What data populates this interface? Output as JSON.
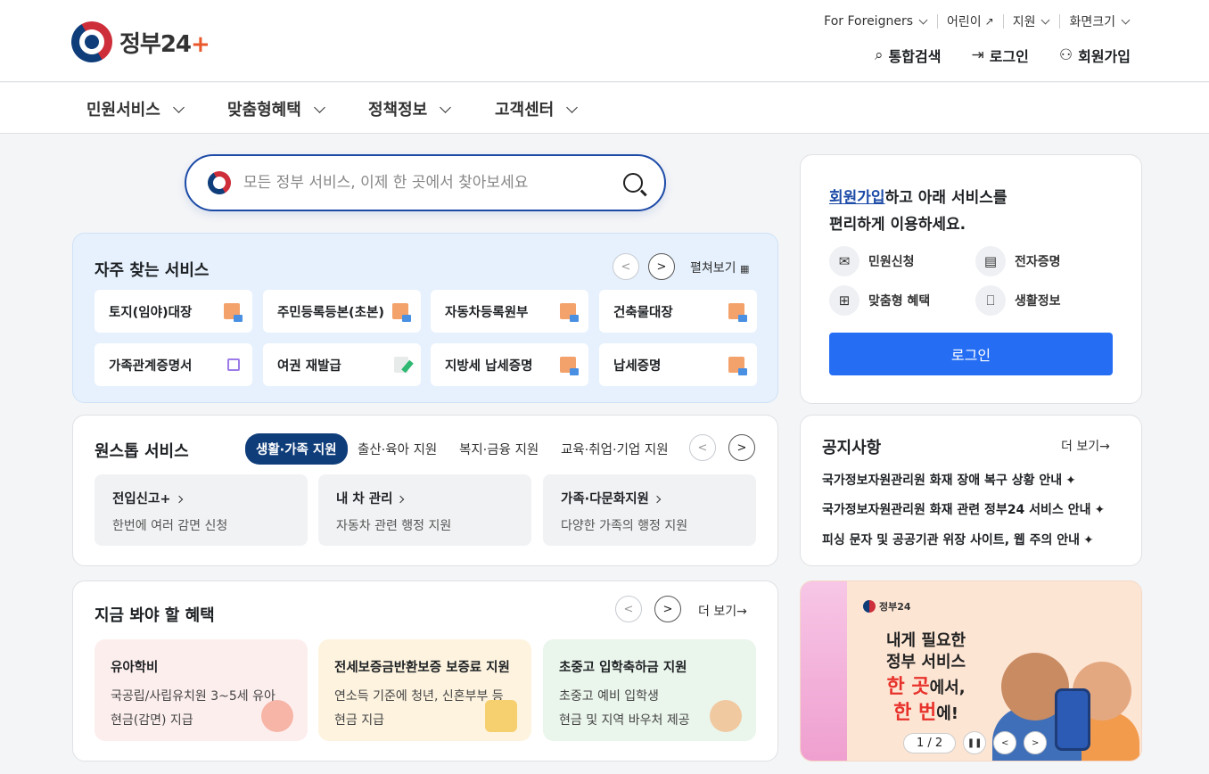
{
  "header": {
    "logo_text": "정부24",
    "logo_plus": "+",
    "util": [
      "For Foreigners",
      "어린이",
      "지원",
      "화면크기"
    ],
    "actions": {
      "search": "통합검색",
      "login": "로그인",
      "signup": "회원가입"
    }
  },
  "gnb": [
    "민원서비스",
    "맞춤형혜택",
    "정책정보",
    "고객센터"
  ],
  "search": {
    "placeholder": "모든 정부 서비스, 이제 한 곳에서 찾아보세요"
  },
  "frequent": {
    "title": "자주 찾는 서비스",
    "expand": "펼쳐보기",
    "items": [
      "토지(임야)대장",
      "주민등록등본(초본)",
      "자동차등록원부",
      "건축물대장",
      "가족관계증명서",
      "여권 재발급",
      "지방세 납세증명",
      "납세증명"
    ]
  },
  "onestop": {
    "title": "원스톱 서비스",
    "tabs": [
      "생활·가족 지원",
      "출산·육아 지원",
      "복지·금융 지원",
      "교육·취업·기업 지원"
    ],
    "boxes": [
      {
        "title": "전입신고+",
        "desc": "한번에 여러 감면 신청"
      },
      {
        "title": "내 차 관리",
        "desc": "자동차 관련 행정 지원"
      },
      {
        "title": "가족·다문화지원",
        "desc": "다양한 가족의 행정 지원"
      }
    ]
  },
  "benefit": {
    "title": "지금 봐야 할 혜택",
    "more": "더 보기→",
    "boxes": [
      {
        "title": "유아학비",
        "line1": "국공립/사립유치원 3~5세 유아",
        "line2": "현금(감면) 지급",
        "bg": "#fdeeee"
      },
      {
        "title": "전세보증금반환보증 보증료 지원",
        "line1": "연소득 기준에 청년, 신혼부부 등",
        "line2": "현금 지급",
        "bg": "#fdf3df"
      },
      {
        "title": "초중고 입학축하금 지원",
        "line1": "초중고 예비 입학생",
        "line2": "현금 및 지역 바우처 제공",
        "bg": "#eaf5ec"
      }
    ]
  },
  "login_card": {
    "highlight": "회원가입",
    "text1": "하고 아래 서비스를",
    "text2": "편리하게 이용하세요.",
    "services": [
      "민원신청",
      "전자증명",
      "맞춤형 혜택",
      "생활정보"
    ],
    "button": "로그인"
  },
  "notice": {
    "title": "공지사항",
    "more": "더 보기→",
    "items": [
      "국가정보자원관리원 화재 장애 복구 상황 안내",
      "국가정보자원관리원 화재 관련 정부24 서비스 안내",
      "피싱 문자 및 공공기관 위장 사이트, 웹 주의 안내"
    ]
  },
  "banner": {
    "logo": "정부24",
    "line1": "내게 필요한",
    "line2": "정부 서비스",
    "line3a": "한 곳",
    "line3b": "에서,",
    "line4a": "한 번",
    "line4b": "에!",
    "page": "1 / 2"
  }
}
